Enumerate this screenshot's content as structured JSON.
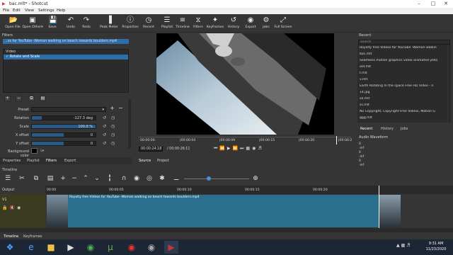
{
  "window": {
    "title": "bac.mlt* - Shotcut",
    "min": "–",
    "max": "□",
    "close": "✕"
  },
  "menu": [
    "File",
    "Edit",
    "View",
    "Settings",
    "Help"
  ],
  "toolbar": [
    {
      "label": "Open File",
      "icon": "folder-open-icon",
      "glyph": "📂"
    },
    {
      "label": "Open Other▾",
      "icon": "open-other-icon",
      "glyph": "▣"
    },
    {
      "label": "Save",
      "icon": "save-icon",
      "glyph": "💾"
    },
    {
      "label": "Undo",
      "icon": "undo-icon",
      "glyph": "↶"
    },
    {
      "label": "Redo",
      "icon": "redo-icon",
      "glyph": "↷"
    },
    {
      "label": "Peak Meter",
      "icon": "peak-meter-icon",
      "glyph": "▐"
    },
    {
      "label": "Properties",
      "icon": "properties-icon",
      "glyph": "ⓘ"
    },
    {
      "label": "Recent",
      "icon": "recent-icon",
      "glyph": "◷"
    },
    {
      "label": "Playlist",
      "icon": "playlist-icon",
      "glyph": "☰"
    },
    {
      "label": "Timeline",
      "icon": "timeline-icon",
      "glyph": "≡"
    },
    {
      "label": "Filters",
      "icon": "filters-icon",
      "glyph": "⧖"
    },
    {
      "label": "Keyframes",
      "icon": "keyframes-icon",
      "glyph": "✦"
    },
    {
      "label": "History",
      "icon": "history-icon",
      "glyph": "↺"
    },
    {
      "label": "Export",
      "icon": "export-icon",
      "glyph": "◉"
    },
    {
      "label": "Jobs",
      "icon": "jobs-icon",
      "glyph": "⚙"
    },
    {
      "label": "Full Screen",
      "icon": "fullscreen-icon",
      "glyph": "⤢"
    }
  ],
  "filters": {
    "title": "Filters",
    "clip_name": "...os for YouTube -Woman walking on beach towards boulders.mp4",
    "group": "Video",
    "items": [
      "✓ Rotate and Scale"
    ],
    "preset_label": "Preset",
    "params": [
      {
        "label": "Rotation",
        "value": "-127.3 deg",
        "fill": 0.15
      },
      {
        "label": "Scale",
        "value": "100.0 %",
        "fill": 1.0
      },
      {
        "label": "X offset",
        "value": "0",
        "fill": 0.5
      },
      {
        "label": "Y offset",
        "value": "0",
        "fill": 0.5
      }
    ],
    "bgcolor_label": "Background color",
    "tabs": [
      "Properties",
      "Playlist",
      "Filters",
      "Export"
    ]
  },
  "viewer": {
    "ticks": [
      "00:00:00",
      "|00:00:04",
      "|00:00:09",
      "|00:00:15",
      "|00:00:20",
      "|00:00:2"
    ],
    "current_time": "00:00:24:18",
    "duration": "/ 00:00:26:11",
    "tabs": [
      "Source",
      "Project"
    ]
  },
  "recent": {
    "title": "Recent",
    "search_placeholder": "search",
    "items": [
      "Royalty free Videos for YouTube -Woman walkin",
      "bac.mlt",
      "Seamless motion graphics video animated yello",
      "old.mlt",
      "t.mlt",
      "v.mlt",
      "Earth Rotating   In the space  Free HD Video - n",
      "14.jpg",
      "sd.mlt",
      "ss.mlt",
      "No Copyright, Copyright Free Videos, Motion G",
      "ggg.mlt"
    ],
    "tabs": [
      "Recent",
      "History",
      "Jobs"
    ],
    "audio_title": "Audio Waveform",
    "audio_ticks": [
      "0",
      "-inf",
      "0",
      "-inf",
      "0",
      "-inf"
    ]
  },
  "timeline": {
    "title": "Timeline",
    "output_label": "Output",
    "track_name": "V1",
    "ruler": [
      "00:00",
      "00:00:05",
      "00:00:10",
      "00:00:15",
      "00:00:20"
    ],
    "clip_title": "Royalty free Videos for YouTube -Woman walking on beach towards boulders.mp4",
    "bottom_tabs": [
      "Timeline",
      "Keyframes"
    ]
  },
  "taskbar": {
    "time": "9:31 AM",
    "date": "11/23/2020"
  },
  "colors": {
    "accent": "#2d6ea8",
    "clip": "#2b6f8e",
    "bg": "#353535"
  }
}
